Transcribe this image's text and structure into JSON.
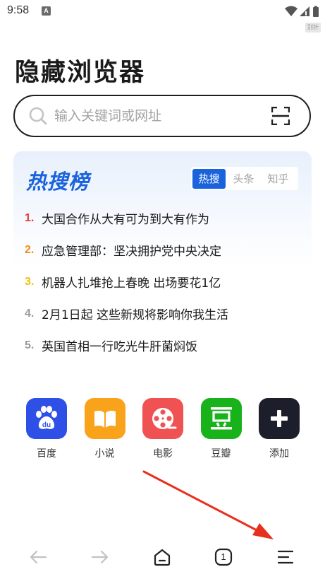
{
  "status_bar": {
    "time": "9:58",
    "app_badge": "A",
    "corner_tag": "别针"
  },
  "app": {
    "title": "隐藏浏览器"
  },
  "search": {
    "placeholder": "输入关键词或网址"
  },
  "hot": {
    "title": "热搜榜",
    "tabs": [
      {
        "label": "热搜",
        "active": true
      },
      {
        "label": "头条",
        "active": false
      },
      {
        "label": "知乎",
        "active": false
      }
    ],
    "items": [
      {
        "rank": "1.",
        "text": "大国合作从大有可为到大有作为",
        "color": "#e53935"
      },
      {
        "rank": "2.",
        "text": "应急管理部：坚决拥护党中央决定",
        "color": "#f08c1a"
      },
      {
        "rank": "3.",
        "text": "机器人扎堆抢上春晚 出场要花1亿",
        "color": "#f2c200"
      },
      {
        "rank": "4.",
        "text": "2月1日起 这些新规将影响你我生活",
        "color": "#9a9a9a"
      },
      {
        "rank": "5.",
        "text": "英国首相一行吃光牛肝菌焖饭",
        "color": "#9a9a9a"
      }
    ]
  },
  "shortcuts": [
    {
      "label": "百度",
      "icon": "baidu-paw-icon",
      "color": "#2f50e6"
    },
    {
      "label": "小说",
      "icon": "book-icon",
      "color": "#f9a31b"
    },
    {
      "label": "电影",
      "icon": "film-reel-icon",
      "color": "#f05152"
    },
    {
      "label": "豆瓣",
      "icon": "douban-icon",
      "color": "#18b21b"
    },
    {
      "label": "添加",
      "icon": "plus-icon",
      "color": "#1d1e2b"
    }
  ],
  "bottom_nav": {
    "tab_count": "1",
    "items": [
      "back-arrow-icon",
      "forward-arrow-icon",
      "home-icon",
      "tabs-icon",
      "menu-icon"
    ]
  },
  "annotation": {
    "arrow_color": "#e8301e"
  }
}
